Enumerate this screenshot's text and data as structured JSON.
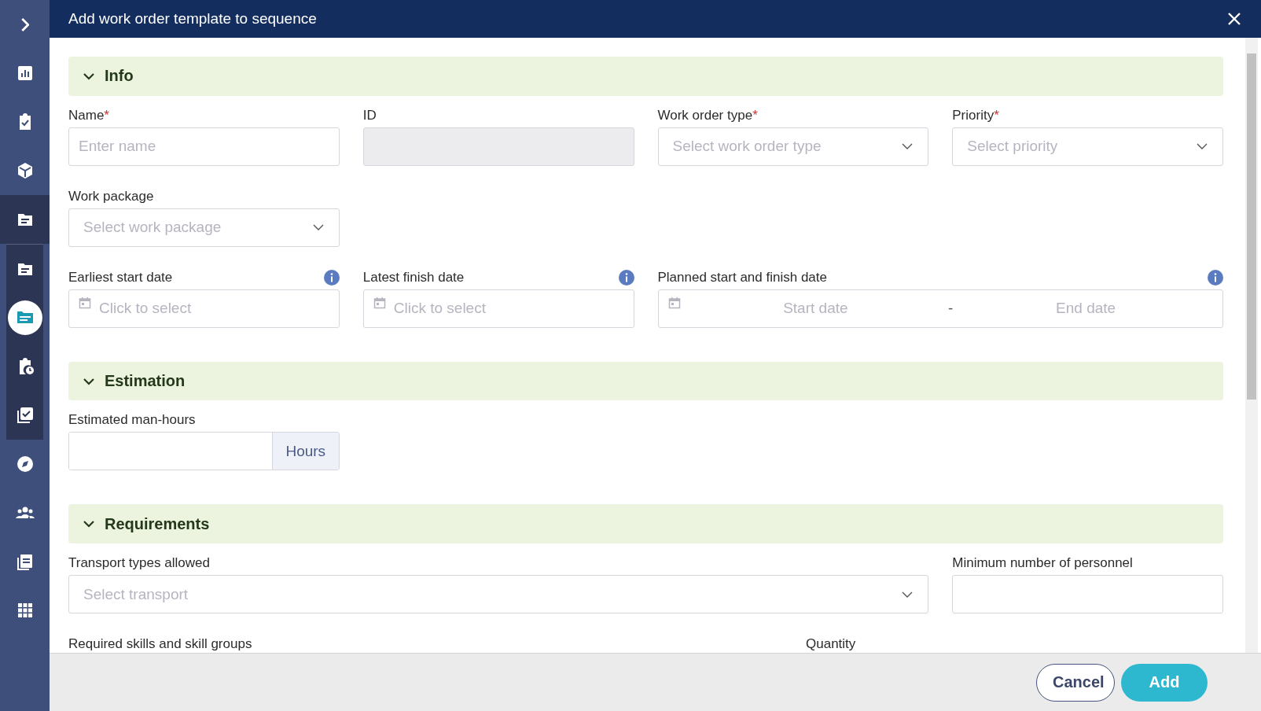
{
  "sidebar": {
    "groups": [
      {
        "kind": "main",
        "items": [
          {
            "kind": "expand",
            "selected": false
          },
          {
            "kind": "chart",
            "selected": false
          },
          {
            "kind": "clipboard-check",
            "selected": false
          },
          {
            "kind": "cube",
            "selected": false
          }
        ]
      },
      {
        "kind": "context",
        "items": [
          {
            "kind": "document",
            "selected": false
          }
        ]
      },
      {
        "kind": "context",
        "items": [
          {
            "kind": "document",
            "selected": false
          },
          {
            "kind": "folders",
            "selected": true
          },
          {
            "kind": "clipboard-clock",
            "selected": false
          },
          {
            "kind": "checklist",
            "selected": false
          }
        ]
      },
      {
        "kind": "main",
        "items": [
          {
            "kind": "compass",
            "selected": false
          },
          {
            "kind": "people",
            "selected": false
          },
          {
            "kind": "notes",
            "selected": false
          },
          {
            "kind": "grid",
            "selected": false
          }
        ]
      }
    ]
  },
  "dialog": {
    "title": "Add work order template to sequence",
    "sections": [
      {
        "title": "Info",
        "expanded": true,
        "rows": [
          [
            {
              "kind": "text",
              "label": "Name",
              "required_mark": "*",
              "placeholder": "Enter name"
            },
            {
              "kind": "readonly",
              "label": "ID"
            },
            {
              "kind": "select",
              "label": "Work order type",
              "required_mark": "*",
              "placeholder": "Select work order type"
            },
            {
              "kind": "select",
              "label": "Priority",
              "required_mark": "*",
              "placeholder": "Select priority"
            }
          ],
          [
            {
              "kind": "select",
              "label": "Work package",
              "placeholder": "Select work package"
            }
          ],
          [
            {
              "kind": "date",
              "label": "Earliest start date",
              "info": true,
              "placeholder": "Click to select"
            },
            {
              "kind": "date",
              "label": "Latest finish date",
              "info": true,
              "placeholder": "Click to select"
            },
            {
              "kind": "daterange",
              "label": "Planned start and finish date",
              "info": true,
              "start_placeholder": "Start date",
              "separator": "-",
              "end_placeholder": "End date"
            }
          ]
        ]
      },
      {
        "title": "Estimation",
        "expanded": true,
        "rows": [
          [
            {
              "kind": "addon",
              "label": "Estimated man-hours",
              "addon": "Hours"
            }
          ]
        ]
      },
      {
        "title": "Requirements",
        "expanded": true,
        "rows": [
          [
            {
              "kind": "multiselect",
              "label": "Transport types allowed",
              "placeholder": "Select transport"
            },
            {
              "kind": "text",
              "label": "Minimum number of personnel"
            }
          ],
          [
            {
              "kind": "cut",
              "label": "Required skills and skill groups"
            },
            {
              "kind": "cut",
              "label": "Quantity"
            }
          ]
        ]
      }
    ]
  },
  "buttons": [
    {
      "label": "Cancel",
      "kind": "secondary"
    },
    {
      "label": "Add",
      "kind": "primary"
    }
  ]
}
